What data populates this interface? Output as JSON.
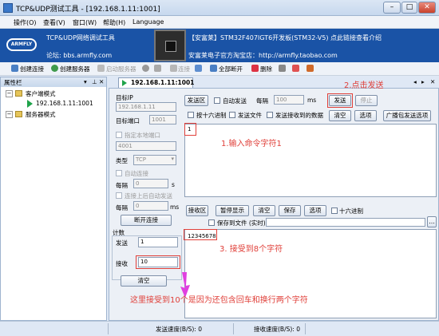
{
  "window": {
    "title": "TCP&UDP测试工具 - [192.168.1.11:1001]",
    "controls": [
      "–",
      "□",
      "✕"
    ]
  },
  "menu": [
    "操作(O)",
    "查看(V)",
    "窗口(W)",
    "帮助(H)",
    "Language"
  ],
  "banner": {
    "logo": "ARMFLY",
    "title": "TCP&UDP网络调试工具",
    "forum": "论坛: bbs.armfly.com",
    "ad_line": "【安富莱】STM32F407IGT6开发板(STM32-V5) 点此链接查看介绍",
    "shop": "安富莱电子官方淘宝店：http://armfly.taobao.com"
  },
  "toolbar": {
    "items": [
      "创建连接",
      "创建服务器",
      "启动服务器",
      "",
      "连接",
      "",
      "全部断开",
      "删除",
      "",
      ""
    ]
  },
  "sidebar": {
    "title": "属性栏",
    "header_icons": [
      "▾",
      "⊥",
      "✕"
    ],
    "tree": [
      {
        "label": "客户端模式"
      },
      {
        "label": "192.168.1.11:1001"
      },
      {
        "label": "服务器模式"
      }
    ]
  },
  "tab": {
    "label": "192.168.1.11:1001",
    "close": "✕"
  },
  "tab_nav": [
    "◂",
    "▸",
    "✕"
  ],
  "left_panel": {
    "target_ip_label": "目标IP",
    "target_ip_value": "192.168.1.11",
    "target_port_label": "目标端口",
    "target_port_value": "1001",
    "local_port_label": "指定本地端口",
    "local_port_value": "4001",
    "type_label": "类型",
    "type_value": "TCP",
    "auto_connect_label": "自动连接",
    "interval_label": "每隔",
    "interval_value": "0",
    "interval_unit": "s",
    "auto_send_label": "连接上后自动发送",
    "interval2_label": "每隔",
    "interval2_value": "0",
    "interval2_unit": "ms",
    "disconnect_button": "断开连接",
    "count_label": "计数",
    "send_label": "发送",
    "send_value": "1",
    "recv_label": "接收",
    "recv_value": "10",
    "clear_button": "清空"
  },
  "send_section": {
    "area_label": "发送区",
    "auto_send": "自动发送",
    "every": "每隔",
    "every_value": "100",
    "unit": "ms",
    "send_button": "发送",
    "stop_button": "停止",
    "hex_send": "按十六进制",
    "send_file": "发送文件",
    "send_received": "发送接收到的数据",
    "clear_button": "清空",
    "options_button": "选项",
    "broadcast_button": "广播包发送选项",
    "content": "1"
  },
  "recv_section": {
    "area_label": "接收区",
    "pause_button": "暂停显示",
    "clear_button": "清空",
    "save_button": "保存",
    "options_button": "选项",
    "hex_display": "十六进制",
    "save_to_file": "保存到文件 (实时)",
    "content": "12345678"
  },
  "annotations": {
    "click_send": "2.点击发送",
    "input_cmd": "1.输入命令字符1",
    "received_8": "3. 接受到8个字符",
    "explain": "这里接受到10个是因为还包含回车和换行两个字符"
  },
  "status": {
    "send_rate": "发送速度(B/S): 0",
    "recv_rate": "接收速度(B/S): 0"
  },
  "colors": {
    "annotation": "#e0403a",
    "banner": "#1a53a6",
    "arrow": "#e040e0"
  }
}
